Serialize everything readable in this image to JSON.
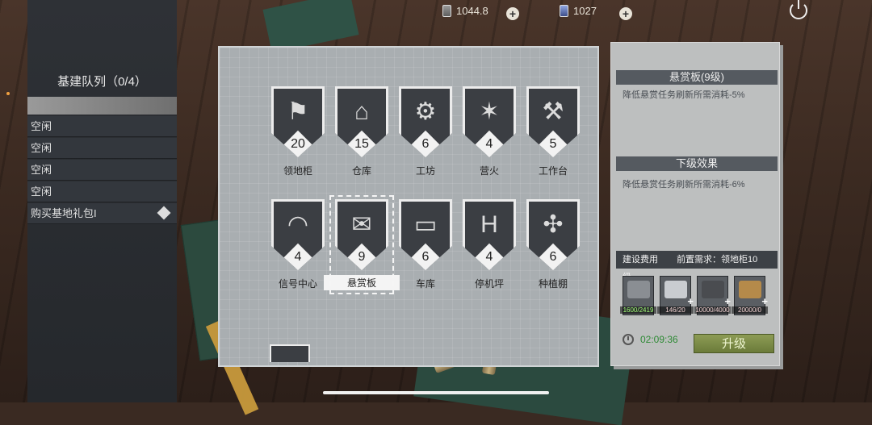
{
  "resources": [
    {
      "icon": "silver-bar-icon",
      "value": "1044.8"
    },
    {
      "icon": "blue-card-icon",
      "value": "1027"
    }
  ],
  "queue": {
    "title": "基建队列（0/4）",
    "items": [
      "空闲",
      "空闲",
      "空闲",
      "空闲"
    ],
    "gift_label": "购买基地礼包I"
  },
  "buildings": [
    {
      "name": "领地柜",
      "level": "20",
      "icon": "flag-mountain-icon"
    },
    {
      "name": "仓库",
      "level": "15",
      "icon": "barn-icon"
    },
    {
      "name": "工坊",
      "level": "6",
      "icon": "workshop-icon"
    },
    {
      "name": "营火",
      "level": "4",
      "icon": "campfire-icon"
    },
    {
      "name": "工作台",
      "level": "5",
      "icon": "microscope-tools-icon"
    },
    {
      "name": "信号中心",
      "level": "4",
      "icon": "satellite-dish-icon"
    },
    {
      "name": "悬赏板",
      "level": "9",
      "icon": "wanted-poster-icon"
    },
    {
      "name": "车库",
      "level": "6",
      "icon": "garage-car-icon"
    },
    {
      "name": "停机坪",
      "level": "4",
      "icon": "helipad-icon"
    },
    {
      "name": "种植棚",
      "level": "6",
      "icon": "windmill-field-icon"
    }
  ],
  "info": {
    "title": "悬赏板(9级)",
    "current_effect": "降低悬赏任务刷新所需消耗-5%",
    "next_title": "下级效果",
    "next_effect": "降低悬赏任务刷新所需消耗-6%",
    "cost_label": "建设费用",
    "requirement": "前置需求：领地柜10级",
    "costs": [
      {
        "icon": "machine-parts-icon",
        "amount": "1600/2419",
        "ok": true,
        "color": "#8a8e93"
      },
      {
        "icon": "steel-ingot-icon",
        "amount": "146/20",
        "ok": false,
        "color": "#c9ccd0"
      },
      {
        "icon": "dark-metal-icon",
        "amount": "10000/4000",
        "ok": false,
        "color": "#4a4c50"
      },
      {
        "icon": "wood-logs-icon",
        "amount": "20000/0",
        "ok": false,
        "color": "#b58a4a"
      }
    ],
    "timer": "02:09:36",
    "upgrade_label": "升级"
  }
}
